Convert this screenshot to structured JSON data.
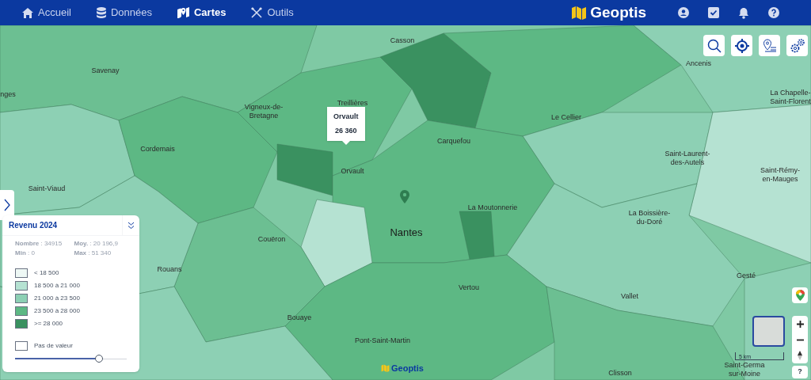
{
  "nav": {
    "items": [
      {
        "label": "Accueil",
        "kind": "home",
        "selected": false
      },
      {
        "label": "Données",
        "kind": "data",
        "selected": false
      },
      {
        "label": "Cartes",
        "kind": "map",
        "selected": true
      },
      {
        "label": "Outils",
        "kind": "tools",
        "selected": false
      }
    ],
    "logo": "Geoptis"
  },
  "map": {
    "places": [
      {
        "name": "Casson"
      },
      {
        "name": "Savenay"
      },
      {
        "name": "Ancenis"
      },
      {
        "name": "nges"
      },
      {
        "name": "La Chapelle-\nSaint-Florent"
      },
      {
        "name": "Vigneux-de-\nBretagne"
      },
      {
        "name": "Treillières"
      },
      {
        "name": "Le Cellier"
      },
      {
        "name": "Cordemais"
      },
      {
        "name": "Carquefou"
      },
      {
        "name": "Saint-Laurent-\ndes-Autels"
      },
      {
        "name": "Orvault"
      },
      {
        "name": "Saint-Rémy-\nen-Mauges"
      },
      {
        "name": "Saint-Viaud"
      },
      {
        "name": "La Moutonnerie"
      },
      {
        "name": "La Boissière-\ndu-Doré"
      },
      {
        "name": "Nantes",
        "major": true
      },
      {
        "name": "Couëron"
      },
      {
        "name": "Rouans"
      },
      {
        "name": "Vertou"
      },
      {
        "name": "Gesté"
      },
      {
        "name": "Vallet"
      },
      {
        "name": "Bouaye"
      },
      {
        "name": "Pont-Saint-Martin"
      },
      {
        "name": "Clisson"
      },
      {
        "name": "Saint-Germa\nsur-Moine"
      }
    ],
    "tooltip": {
      "title": "Orvault",
      "value": "26 360"
    },
    "scale": "5 km",
    "help": "?",
    "watermark": "Geoptis"
  },
  "legend": {
    "title": "Revenu 2024",
    "stats": [
      {
        "text": "**Nombre** : 34915"
      },
      {
        "text": "**Moy.** : 20 196,9"
      },
      {
        "text": "**Min** : 0"
      },
      {
        "text": "**Max** : 51 340"
      }
    ],
    "classes": [
      {
        "label": "< 18 500",
        "color": "#eef8f5"
      },
      {
        "label": "18 500 à 21 000",
        "color": "#b5e2d2"
      },
      {
        "label": "21 000 à 23 500",
        "color": "#8dd0b4"
      },
      {
        "label": "23 500 à 28 000",
        "color": "#5db884"
      },
      {
        "label": ">= 28 000",
        "color": "#3a9160"
      },
      {
        "label": "Pas de valeur",
        "color": "#ffffff"
      }
    ],
    "opacity": {
      "level": 0.75
    }
  }
}
